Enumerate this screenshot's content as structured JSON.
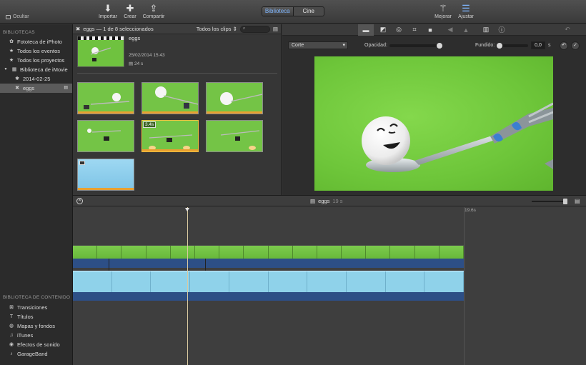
{
  "toolbar": {
    "hide_label": "Ocultar",
    "import_label": "Importar",
    "create_label": "Crear",
    "share_label": "Compartir",
    "tabs": [
      {
        "label": "Biblioteca"
      },
      {
        "label": "Cine"
      }
    ],
    "enhance_label": "Mejorar",
    "adjust_label": "Ajustar"
  },
  "sidebar": {
    "libraries_title": "BIBLIOTECAS",
    "items": [
      {
        "label": "Fototeca de iPhoto"
      },
      {
        "label": "Todos los eventos"
      },
      {
        "label": "Todos los proyectos"
      },
      {
        "label": "Biblioteca de iMovie"
      },
      {
        "label": "2014-02-25"
      },
      {
        "label": "eggs"
      }
    ],
    "content_title": "BIBLIOTECA DE CONTENIDO",
    "content_items": [
      {
        "label": "Transiciones"
      },
      {
        "label": "Títulos"
      },
      {
        "label": "Mapas y fondos"
      },
      {
        "label": "iTunes"
      },
      {
        "label": "Efectos de sonido"
      },
      {
        "label": "GarageBand"
      }
    ]
  },
  "browser": {
    "title": "eggs — 1 de 8 seleccionados",
    "filter": "Todos los clips",
    "event": {
      "name": "eggs",
      "date": "25/02/2014 15:43",
      "count": "24 s"
    },
    "selected_clip_duration": "3.4s"
  },
  "viewer": {
    "transition_type": "Corte",
    "opacity_label": "Opacidad:",
    "fade_label": "Fundido:",
    "fade_value": "0,0",
    "fade_unit": "s"
  },
  "timeline": {
    "project_name": "eggs",
    "project_duration": "19 s",
    "end_time": "19.6s"
  },
  "colors": {
    "accent": "#7fb6ff",
    "greenscreen": "#6ec63a",
    "audio": "#8fd2ea",
    "track_under": "#2d4f86"
  }
}
